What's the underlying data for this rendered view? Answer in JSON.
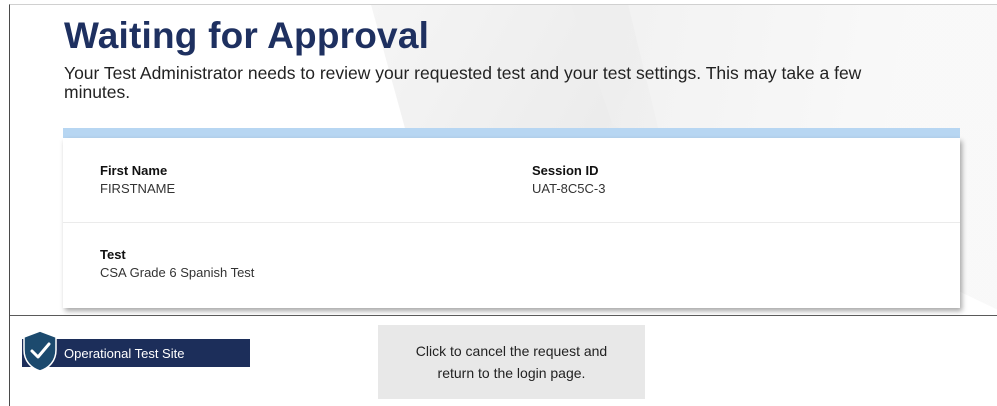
{
  "header": {
    "title": "Waiting for Approval",
    "message": "Your Test Administrator needs to review your requested test and your test settings. This may take a few minutes."
  },
  "details": {
    "first_name": {
      "label": "First Name",
      "value": "FIRSTNAME"
    },
    "session_id": {
      "label": "Session ID",
      "value": "UAT-8C5C-3"
    },
    "test": {
      "label": "Test",
      "value": "CSA Grade 6 Spanish Test"
    }
  },
  "footer": {
    "site_label": "Operational Test Site",
    "site_icon": "shield-check-icon",
    "cancel_line_1": "Click to cancel the request and",
    "cancel_line_2": "return to the login page."
  },
  "colors": {
    "title": "#1e3060",
    "accent_bar": "#b7d6f2",
    "badge": "#1c2e5a",
    "cancel_bg": "#e8e8e8"
  }
}
